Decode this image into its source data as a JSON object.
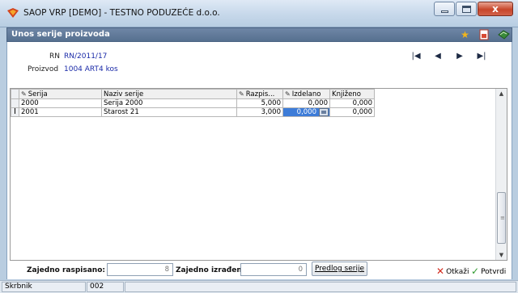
{
  "window": {
    "title": "SAOP VRP [DEMO] - TESTNO PODUZEĆE d.o.o.",
    "close_glyph": "x"
  },
  "form": {
    "title": "Unos serije proizvoda",
    "icons": [
      "star-icon",
      "document-icon",
      "book-icon"
    ]
  },
  "info": {
    "rn_label": "RN",
    "rn_value": "RN/2011/17",
    "product_label": "Proizvod",
    "product_value": "1004 ART4 kos"
  },
  "grid": {
    "columns": [
      "Serija",
      "Naziv serije",
      "Razpis...",
      "Izdelano",
      "Knjiženo"
    ],
    "rows": [
      {
        "serija": "2000",
        "naziv": "Serija 2000",
        "razpis": "5,000",
        "izdelano": "0,000",
        "knjizeno": "0,000"
      },
      {
        "serija": "2001",
        "naziv": "Starost  21",
        "razpis": "3,000",
        "izdelano": "0,000",
        "knjizeno": "0,000"
      }
    ]
  },
  "footer": {
    "total_planned_label": "Zajedno raspisano:",
    "total_planned_value": "8",
    "total_made_label": "Zajedno izrađeno:",
    "total_made_value": "0",
    "suggest_button": "Predlog serije",
    "cancel_label": "Otkaži",
    "confirm_label": "Potvrdi"
  },
  "status": {
    "user": "Skrbnik",
    "code": "002"
  },
  "colors": {
    "selection": "#3d7cd8",
    "link_text": "#1a2aa8",
    "header_bar": "#5f7898"
  }
}
